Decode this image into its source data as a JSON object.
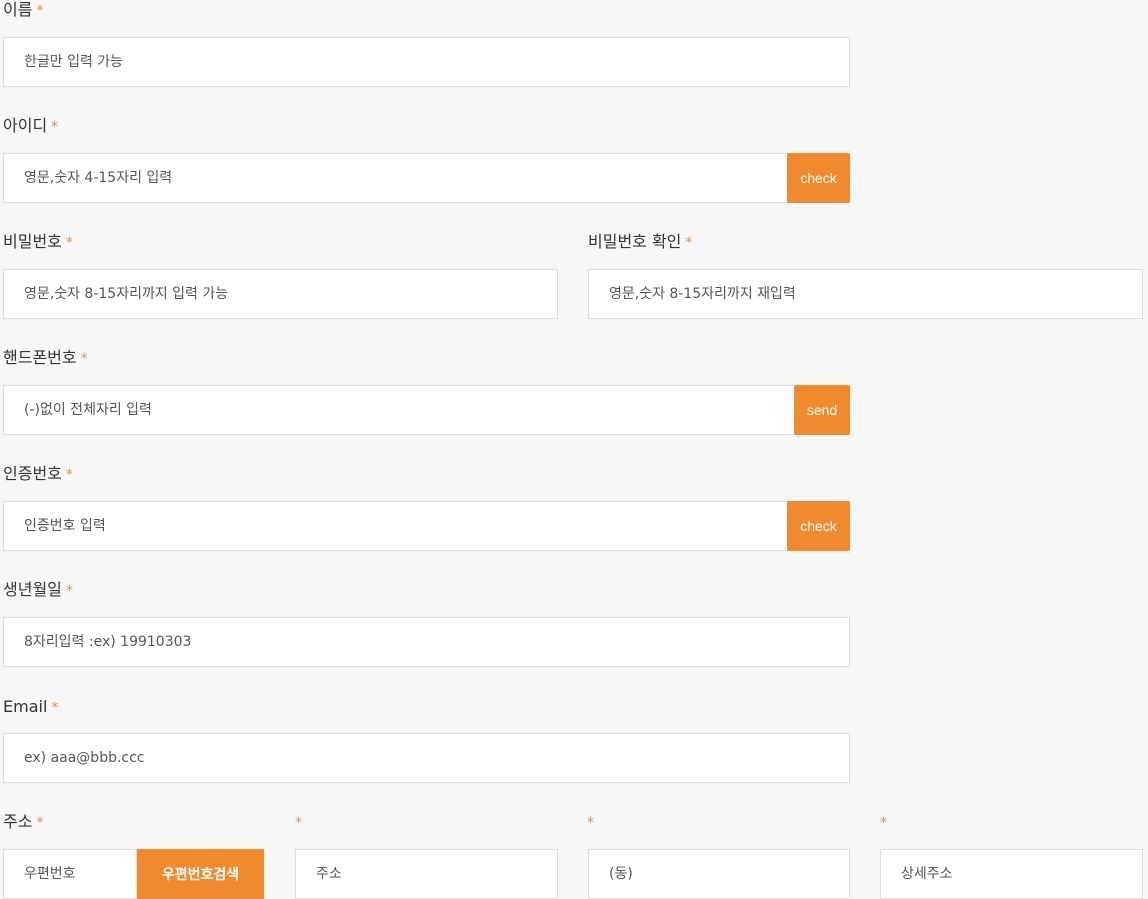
{
  "required_mark": "*",
  "name": {
    "label": "이름",
    "placeholder": "한글만 입력 가능"
  },
  "user_id": {
    "label": "아이디",
    "placeholder": "영문,숫자 4-15자리 입력",
    "check_label": "check"
  },
  "password": {
    "label": "비밀번호",
    "placeholder": "영문,숫자 8-15자리까지 입력 가능"
  },
  "password_confirm": {
    "label": "비밀번호 확인",
    "placeholder": "영문,숫자 8-15자리까지 재입력"
  },
  "phone": {
    "label": "핸드폰번호",
    "placeholder": "(-)없이 전체자리 입력",
    "send_label": "send"
  },
  "auth_code": {
    "label": "인증번호",
    "placeholder": "인증번호 입력",
    "check_label": "check"
  },
  "birth": {
    "label": "생년월일",
    "placeholder": "8자리입력 :ex) 19910303"
  },
  "email": {
    "label": "Email",
    "placeholder": "ex) aaa@bbb.ccc"
  },
  "address": {
    "label": "주소",
    "postcode_placeholder": "우편번호",
    "postcode_search_label": "우편번호검색",
    "address_placeholder": "주소",
    "dong_placeholder": "(동)",
    "detail_placeholder": "상세주소"
  },
  "colors": {
    "accent": "#f08a2e",
    "background": "#f7f7f7",
    "border": "#dcdcdc"
  }
}
